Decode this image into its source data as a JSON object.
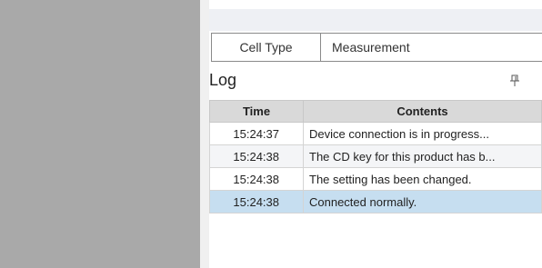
{
  "tabs": {
    "cell_type": "Cell Type",
    "measurement": "Measurement"
  },
  "log": {
    "title": "Log",
    "pin_icon": "pin-icon",
    "columns": {
      "time": "Time",
      "contents": "Contents"
    },
    "rows": [
      {
        "time": "15:24:37",
        "contents": "Device connection is in progress..."
      },
      {
        "time": "15:24:38",
        "contents": "The CD key for this product has b..."
      },
      {
        "time": "15:24:38",
        "contents": "The setting has been changed."
      },
      {
        "time": "15:24:38",
        "contents": "Connected normally."
      }
    ],
    "selected_row": 3
  },
  "colors": {
    "left_panel": "#a9a9a9",
    "header_bg": "#d9d9d9",
    "selected_row": "#c6def0",
    "alt_row": "#f4f5f7"
  }
}
